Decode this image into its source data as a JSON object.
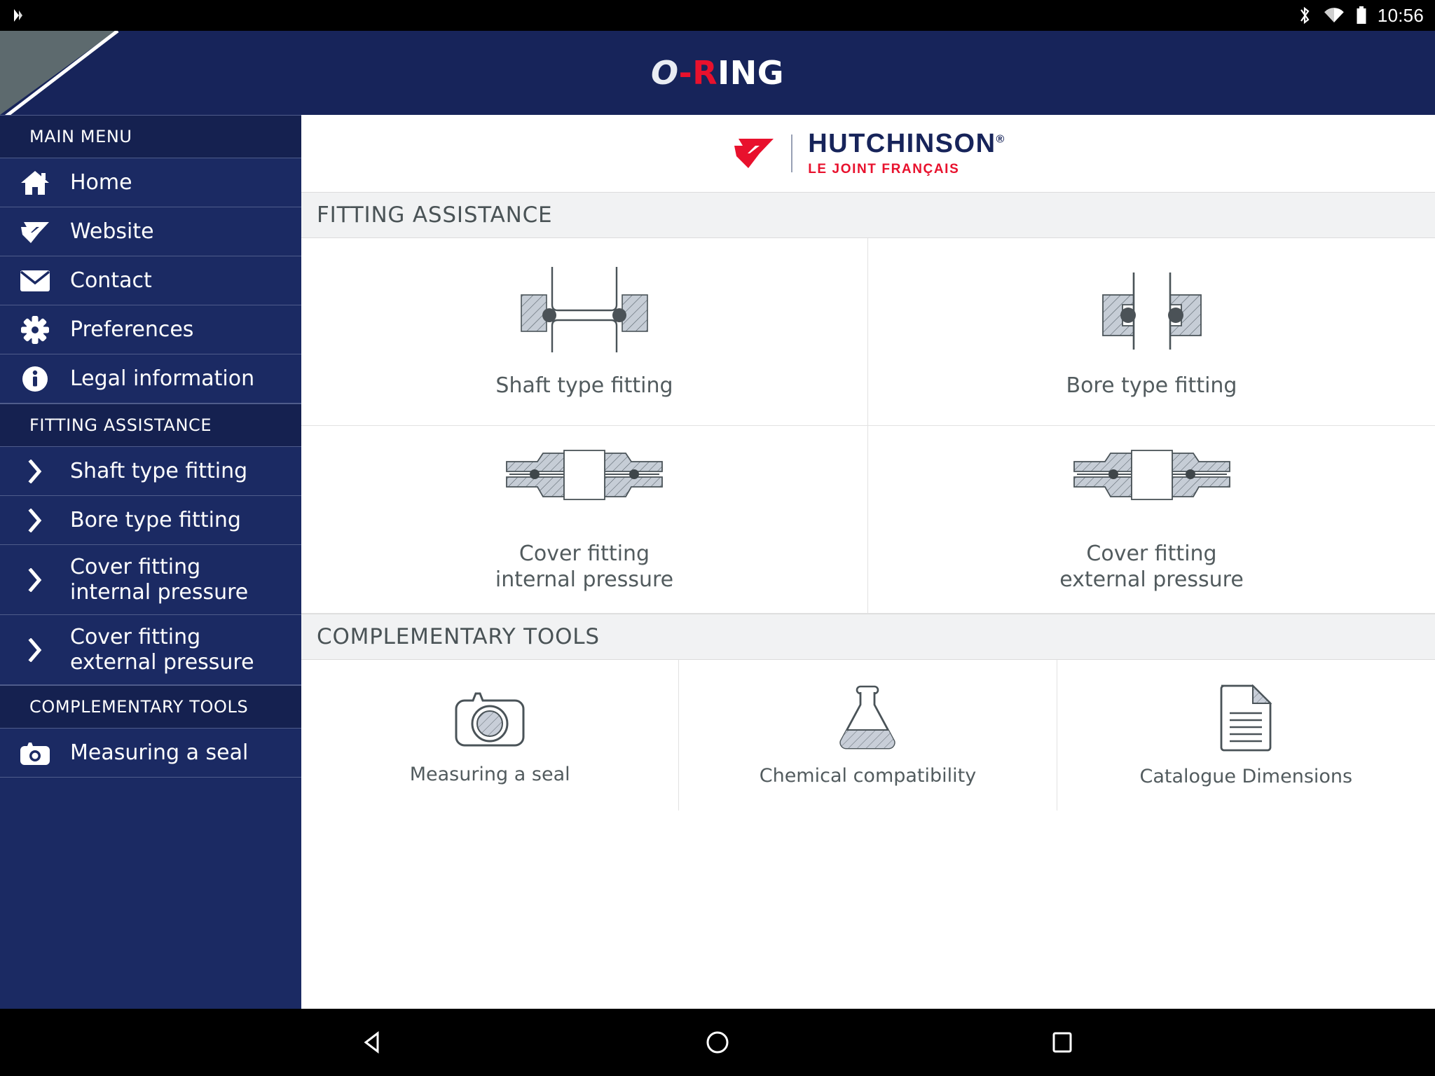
{
  "statusbar": {
    "time": "10:56",
    "icons": [
      "bluetooth-icon",
      "wifi-icon",
      "battery-icon"
    ]
  },
  "header": {
    "title_o": "O",
    "title_dash_r": "-R",
    "title_ing": "ING",
    "colors": {
      "navy": "#17245a",
      "red": "#e8112d",
      "grey_corner": "#5d6a6e"
    }
  },
  "brand": {
    "name": "HUTCHINSON",
    "registered": "®",
    "tagline": "LE JOINT FRANÇAIS"
  },
  "sidebar": {
    "sections": [
      {
        "label": "MAIN MENU"
      },
      {
        "label": "FITTING ASSISTANCE"
      },
      {
        "label": "COMPLEMENTARY TOOLS"
      }
    ],
    "main_menu": [
      {
        "label": "Home",
        "icon": "home-icon"
      },
      {
        "label": "Website",
        "icon": "hutchinson-g-icon"
      },
      {
        "label": "Contact",
        "icon": "envelope-icon"
      },
      {
        "label": "Preferences",
        "icon": "gear-icon"
      },
      {
        "label": "Legal information",
        "icon": "info-icon"
      }
    ],
    "fitting_assistance": [
      {
        "label": "Shaft type fitting",
        "icon": "chevron-right-icon",
        "line1": "Shaft type fitting",
        "line2": ""
      },
      {
        "label": "Bore type fitting",
        "icon": "chevron-right-icon",
        "line1": "Bore type fitting",
        "line2": ""
      },
      {
        "label": "Cover fitting internal pressure",
        "icon": "chevron-right-icon",
        "line1": "Cover fitting",
        "line2": "internal pressure"
      },
      {
        "label": "Cover fitting external pressure",
        "icon": "chevron-right-icon",
        "line1": "Cover fitting",
        "line2": "external pressure"
      }
    ],
    "complementary_tools": [
      {
        "label": "Measuring a seal",
        "icon": "camera-icon"
      }
    ]
  },
  "main": {
    "fitting_assistance": {
      "heading": "FITTING ASSISTANCE",
      "items": [
        {
          "line1": "Shaft type fitting",
          "line2": "",
          "icon": "shaft-type-fitting-diagram"
        },
        {
          "line1": "Bore type fitting",
          "line2": "",
          "icon": "bore-type-fitting-diagram"
        },
        {
          "line1": "Cover fitting",
          "line2": "internal pressure",
          "icon": "cover-fitting-internal-pressure-diagram"
        },
        {
          "line1": "Cover fitting",
          "line2": "external pressure",
          "icon": "cover-fitting-external-pressure-diagram"
        }
      ]
    },
    "complementary_tools": {
      "heading": "COMPLEMENTARY TOOLS",
      "items": [
        {
          "label": "Measuring a seal",
          "icon": "camera-icon"
        },
        {
          "label": "Chemical compatibility",
          "icon": "flask-icon"
        },
        {
          "label": "Catalogue Dimensions",
          "icon": "document-icon"
        }
      ]
    }
  },
  "navbar": {
    "back": "back-button",
    "home": "home-button",
    "recents": "recents-button"
  }
}
